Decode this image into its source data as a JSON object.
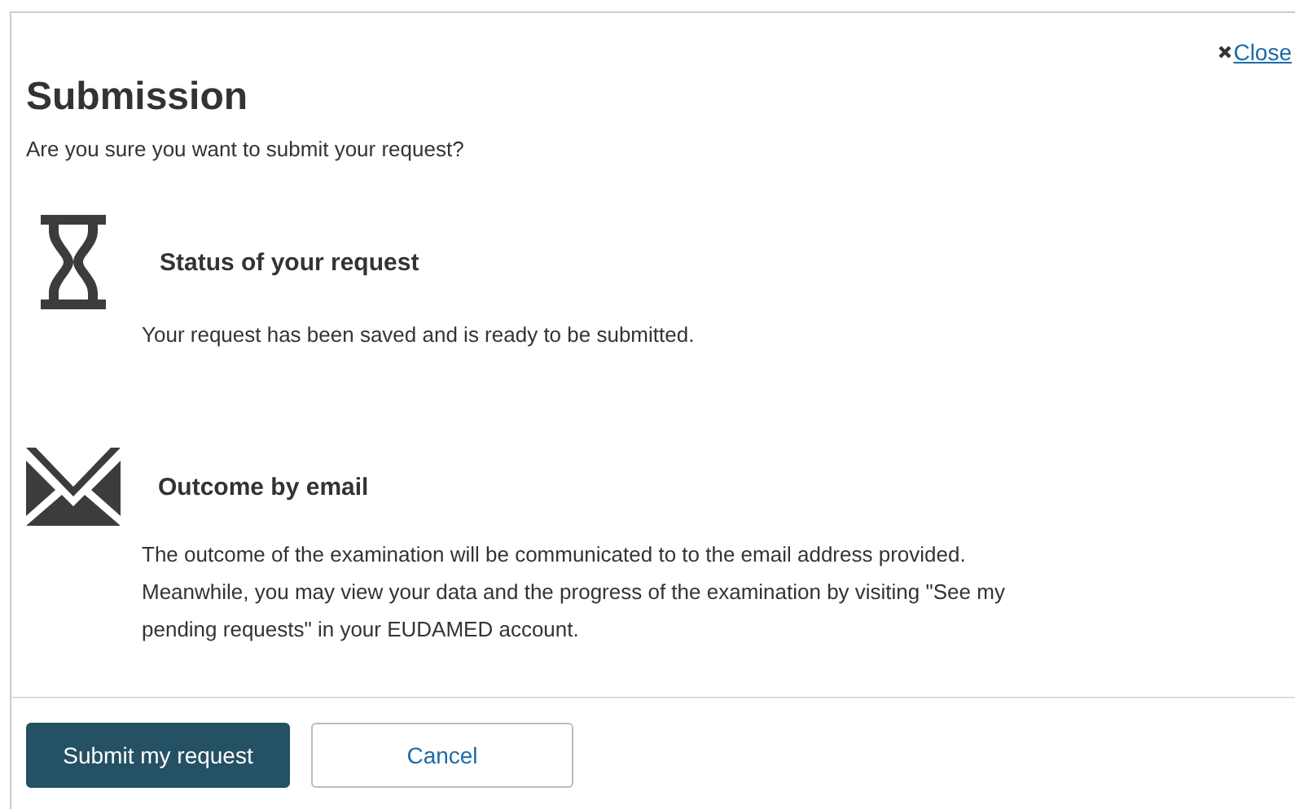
{
  "close": {
    "label": "Close"
  },
  "title": "Submission",
  "subtitle": "Are you sure you want to submit your request?",
  "sections": [
    {
      "kind": "status",
      "heading": "Status of your request",
      "text": "Your request has been saved and is ready to be submitted."
    },
    {
      "kind": "email",
      "heading": "Outcome by email",
      "text": "The outcome of the examination will be communicated to to the email address provided. Meanwhile, you may view your data and the progress of the examination by visiting \"See my pending requests\" in your EUDAMED account."
    }
  ],
  "buttons": [
    {
      "kind": "primary",
      "label": "Submit my request"
    },
    {
      "kind": "secondary",
      "label": "Cancel"
    }
  ]
}
